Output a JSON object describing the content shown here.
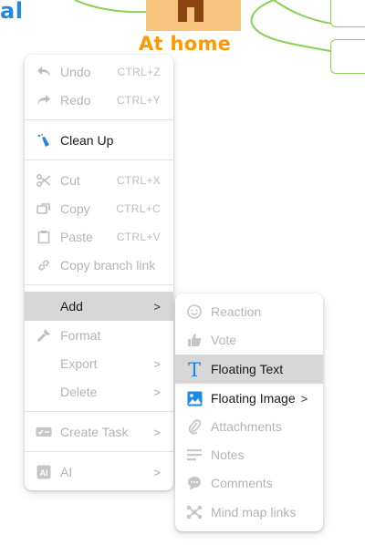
{
  "background": {
    "title_fragment": "al",
    "node_label": "At home",
    "colors": {
      "title": "#1e88e5",
      "node_label": "#ff9900",
      "connector": "#8bcf55",
      "card": "#f6c47d"
    }
  },
  "context_menu": {
    "items": {
      "undo": {
        "label": "Undo",
        "shortcut": "CTRL+Z",
        "icon": "undo-icon"
      },
      "redo": {
        "label": "Redo",
        "shortcut": "CTRL+Y",
        "icon": "redo-icon"
      },
      "clean_up": {
        "label": "Clean Up",
        "icon": "clean-up-icon"
      },
      "cut": {
        "label": "Cut",
        "shortcut": "CTRL+X",
        "icon": "scissors-icon"
      },
      "copy": {
        "label": "Copy",
        "shortcut": "CTRL+C",
        "icon": "copy-icon"
      },
      "paste": {
        "label": "Paste",
        "shortcut": "CTRL+V",
        "icon": "paste-icon"
      },
      "copy_branch_link": {
        "label": "Copy branch link",
        "icon": "link-icon"
      },
      "add": {
        "label": "Add",
        "arrow": ">"
      },
      "format": {
        "label": "Format",
        "icon": "paint-brush-icon"
      },
      "export": {
        "label": "Export",
        "arrow": ">"
      },
      "delete": {
        "label": "Delete",
        "arrow": ">"
      },
      "create_task": {
        "label": "Create Task",
        "arrow": ">",
        "icon": "task-icon"
      },
      "ai": {
        "label": "AI",
        "arrow": ">",
        "icon": "ai-icon"
      }
    }
  },
  "add_submenu": {
    "items": {
      "reaction": {
        "label": "Reaction",
        "icon": "smiley-icon"
      },
      "vote": {
        "label": "Vote",
        "icon": "thumbs-up-icon"
      },
      "floating_text": {
        "label": "Floating Text",
        "icon": "text-t-icon"
      },
      "floating_image": {
        "label": "Floating Image",
        "arrow": ">",
        "icon": "image-icon"
      },
      "attachments": {
        "label": "Attachments",
        "icon": "paperclip-icon"
      },
      "notes": {
        "label": "Notes",
        "icon": "notes-icon"
      },
      "comments": {
        "label": "Comments",
        "icon": "comment-icon"
      },
      "mind_map_links": {
        "label": "Mind map links",
        "icon": "mind-map-links-icon"
      }
    }
  }
}
